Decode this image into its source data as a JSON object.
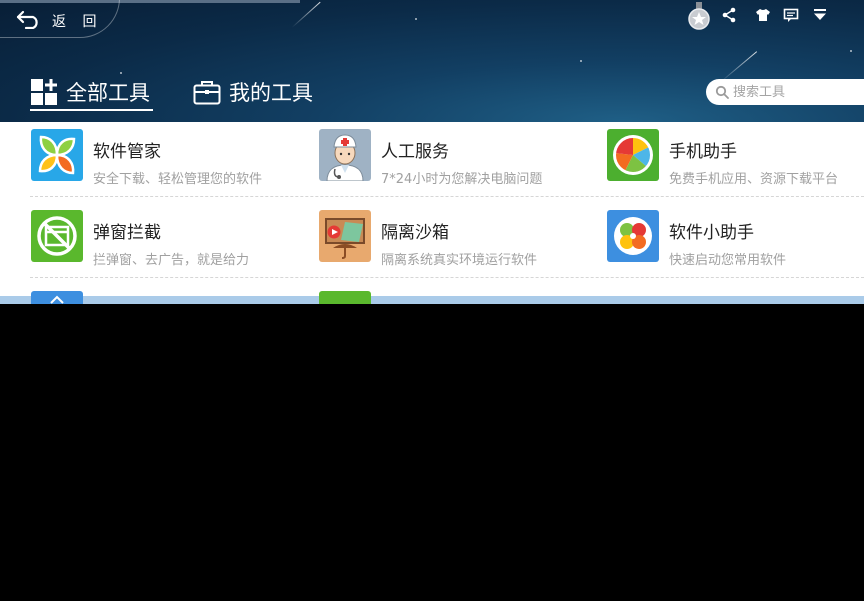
{
  "header": {
    "back_label": "返 回",
    "tabs": [
      {
        "label": "全部工具",
        "icon": "grid-icon",
        "selected": true
      },
      {
        "label": "我的工具",
        "icon": "briefcase-icon",
        "selected": false
      }
    ],
    "search": {
      "placeholder": "搜索工具",
      "value": ""
    },
    "toolbar_icons": [
      "medal-icon",
      "share-icon",
      "shirt-icon",
      "message-icon",
      "dropdown-menu-icon"
    ]
  },
  "tools": [
    {
      "name": "软件管家",
      "desc": "安全下载、轻松管理您的软件",
      "icon": "software-manager-icon"
    },
    {
      "name": "人工服务",
      "desc": "7*24小时为您解决电脑问题",
      "icon": "doctor-icon"
    },
    {
      "name": "手机助手",
      "desc": "免费手机应用、资源下载平台",
      "icon": "phone-assistant-icon"
    },
    {
      "name": "弹窗拦截",
      "desc": "拦弹窗、去广告，就是给力",
      "icon": "popup-block-icon"
    },
    {
      "name": "隔离沙箱",
      "desc": "隔离系统真实环境运行软件",
      "icon": "sandbox-icon"
    },
    {
      "name": "软件小助手",
      "desc": "快速启动您常用软件",
      "icon": "software-helper-icon"
    }
  ],
  "colors": {
    "header_dark": "#0b2a47",
    "accent_blue": "#3d8fe0",
    "green": "#5ab82d"
  }
}
